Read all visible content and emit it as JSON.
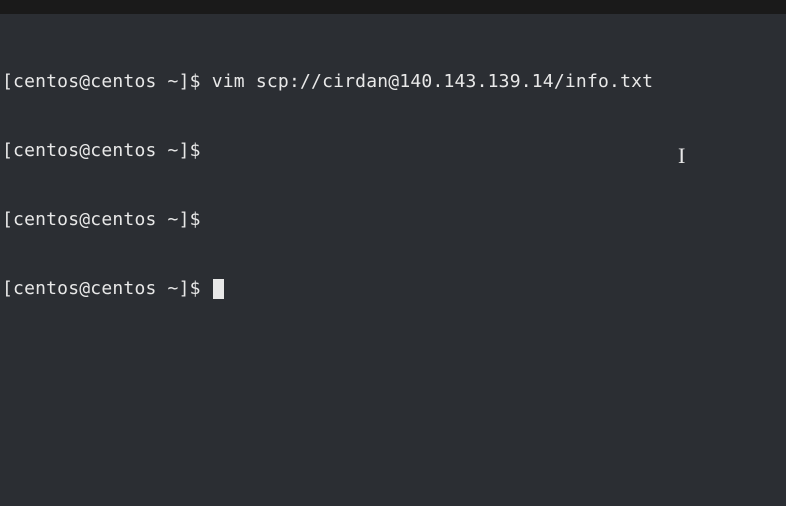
{
  "terminal": {
    "lines": [
      {
        "prompt": "[centos@centos ~]$ ",
        "command": "vim scp://cirdan@140.143.139.14/info.txt",
        "has_cursor": false
      },
      {
        "prompt": "[centos@centos ~]$",
        "command": "",
        "has_cursor": false
      },
      {
        "prompt": "[centos@centos ~]$",
        "command": "",
        "has_cursor": false
      },
      {
        "prompt": "[centos@centos ~]$ ",
        "command": "",
        "has_cursor": true
      }
    ]
  },
  "mouse_cursor_glyph": "I"
}
